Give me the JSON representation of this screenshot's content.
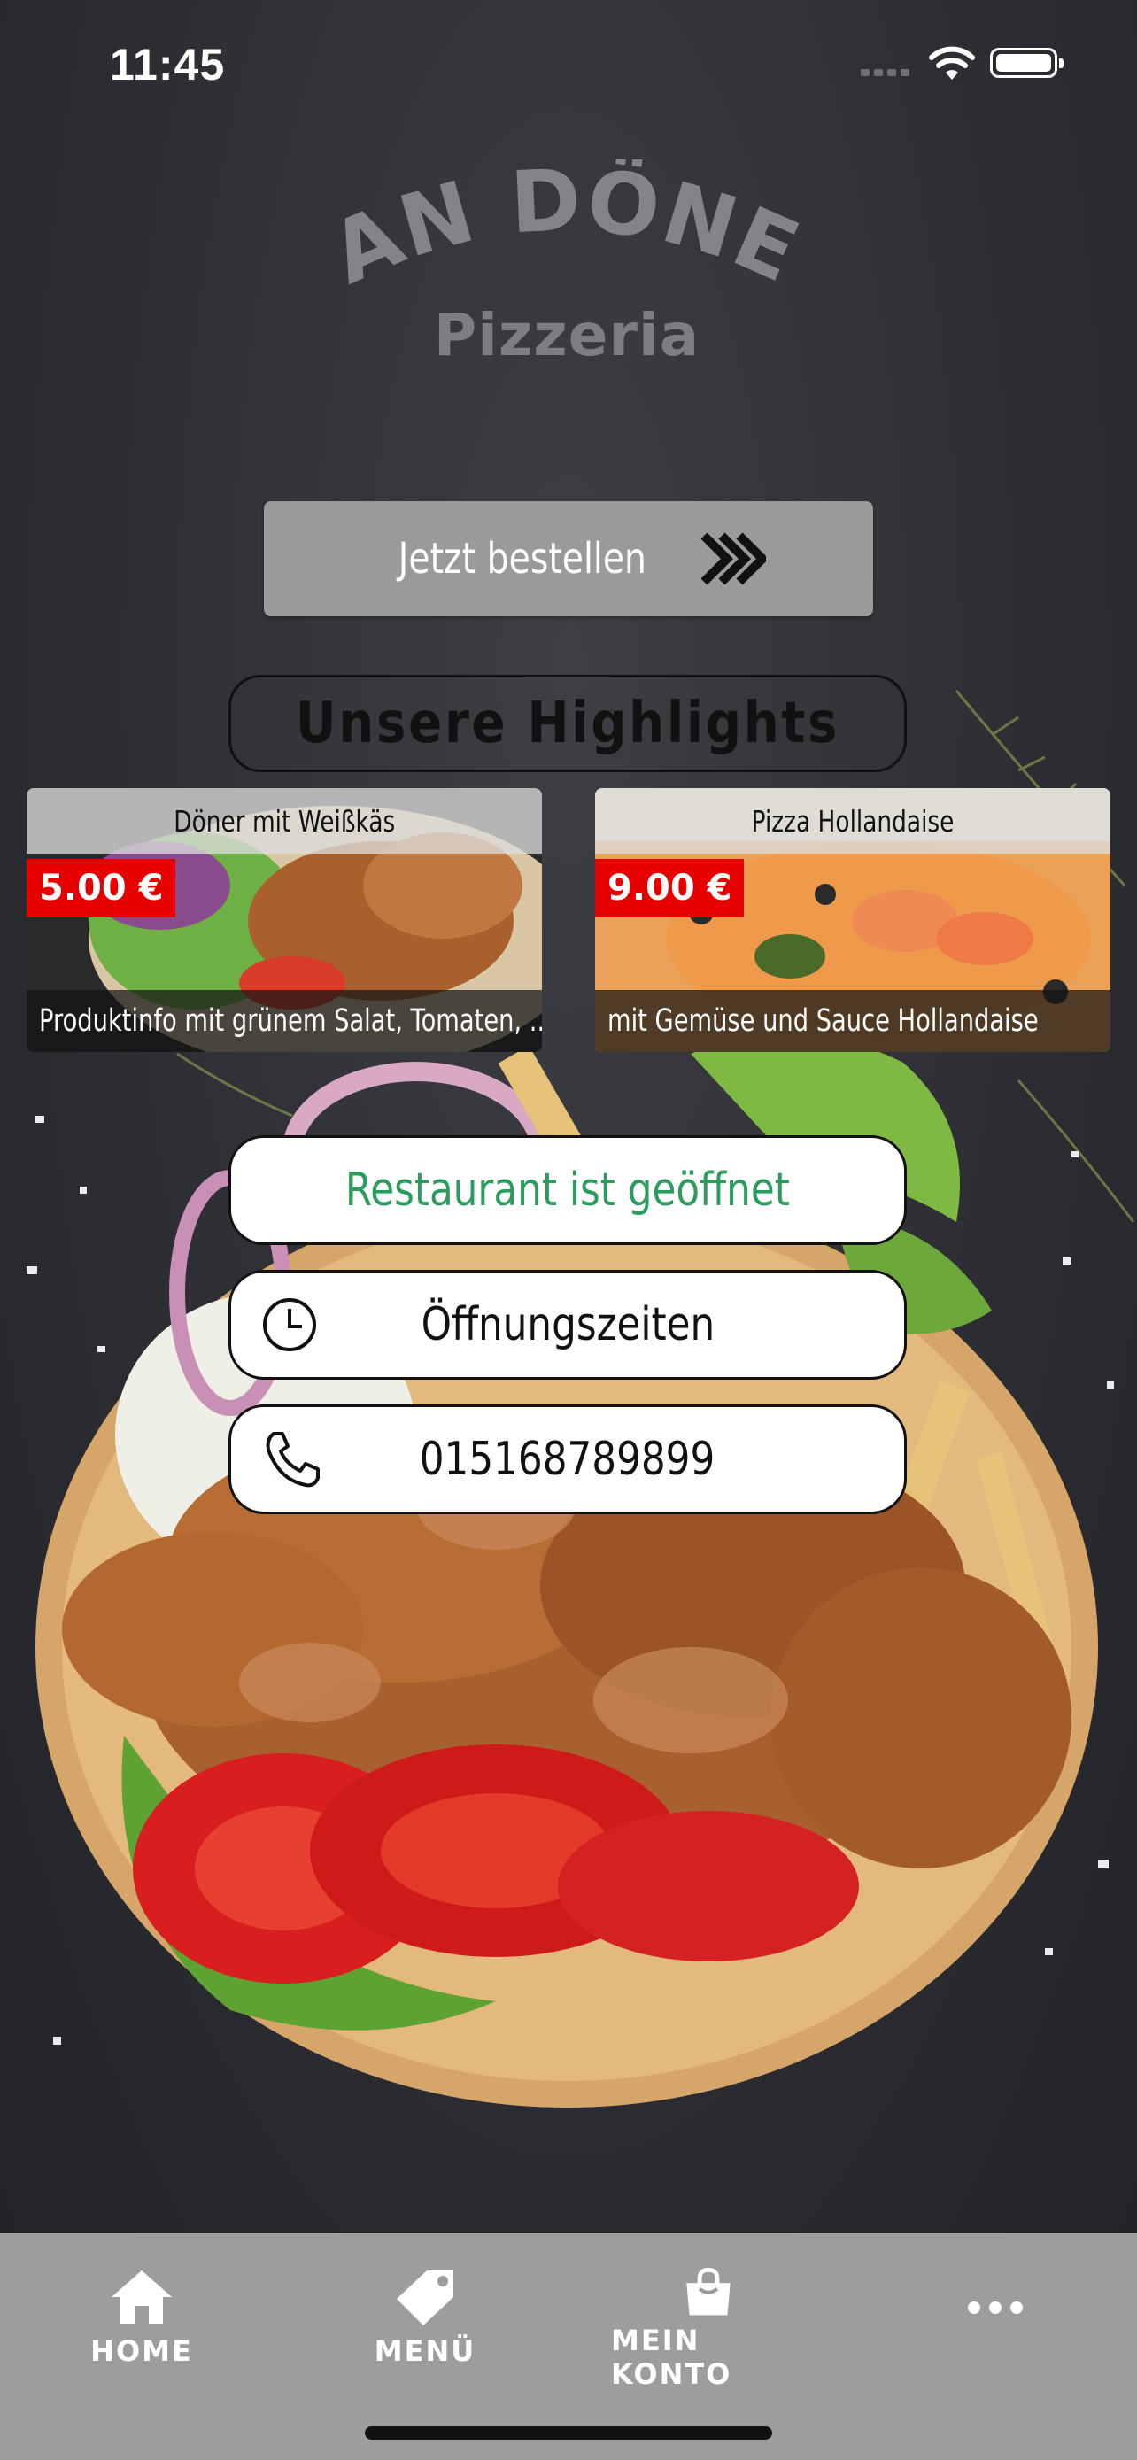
{
  "status_bar": {
    "time": "11:45"
  },
  "brand": {
    "name": "CAN DÖNER",
    "subtitle": "Pizzeria"
  },
  "order_button": {
    "label": "Jetzt bestellen",
    "icon": "double-chevron-right-icon"
  },
  "highlights": {
    "heading": "Unsere Highlights",
    "items": [
      {
        "title": "Döner mit Weißkäs",
        "price": "5.00 €",
        "description": "Produktinfo mit grünem Salat, Tomaten, ..."
      },
      {
        "title": "Pizza Hollandaise",
        "price": "9.00 €",
        "description": "mit Gemüse und Sauce Hollandaise"
      }
    ]
  },
  "info": {
    "status": {
      "label": "Restaurant ist geöffnet",
      "color": "#2a9d5c"
    },
    "hours": {
      "label": "Öffnungszeiten",
      "icon": "clock-icon"
    },
    "phone": {
      "label": "015168789899",
      "icon": "phone-icon"
    }
  },
  "tabbar": {
    "items": [
      {
        "label": "HOME",
        "icon": "home-icon"
      },
      {
        "label": "MENÜ",
        "icon": "tag-icon"
      },
      {
        "label": "MEIN KONTO",
        "icon": "shopping-bag-icon"
      },
      {
        "label": "",
        "icon": "more-icon"
      }
    ]
  }
}
